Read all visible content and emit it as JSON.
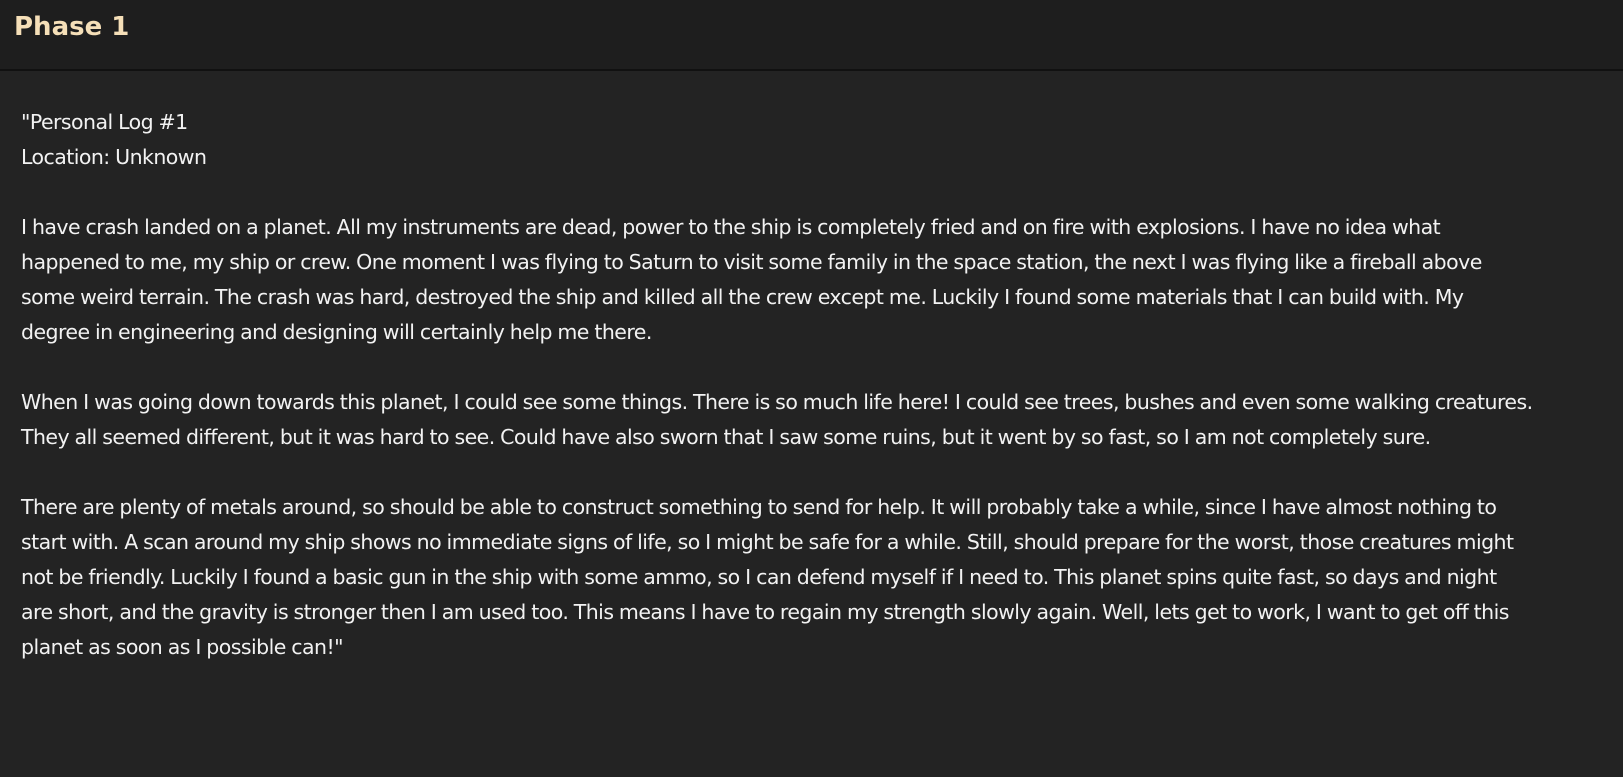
{
  "header": {
    "title": "Phase 1"
  },
  "log": {
    "heading_line": "\"Personal Log #1",
    "location_line": "Location: Unknown",
    "paragraphs": [
      [
        "I have crash landed on a planet. All my instruments are dead, power to the ship is completely fried and on fire with explosions. I have no idea what",
        "happened to me, my ship or crew. One moment I was flying to Saturn to visit some family in the space station, the next I was flying like a fireball above",
        "some weird terrain. The crash was hard, destroyed the ship and killed all the crew except me. Luckily I found some materials that I can build with. My",
        "degree in engineering and designing will certainly help me there."
      ],
      [
        "When I was going down towards this planet, I could see some things. There is so much life here! I could see trees, bushes and even some walking creatures.",
        "They all seemed different, but it was hard to see. Could have also sworn that I saw some ruins, but it went by so fast, so I am not completely sure."
      ],
      [
        "There are plenty of metals around, so should be able to construct something to send for help. It will probably take a while, since I have almost nothing to",
        "start with. A scan around my ship shows no immediate signs of life, so I might be safe for a while. Still, should prepare for the worst, those creatures might",
        "not be friendly. Luckily I found a basic gun in the ship with some ammo, so I can defend myself if I need to. This planet spins quite fast, so days and night",
        "are short, and the gravity is stronger then I am used too. This means I have to regain my strength slowly again. Well, lets get to work, I want to get off this",
        "planet as soon as I possible can!\""
      ]
    ]
  }
}
